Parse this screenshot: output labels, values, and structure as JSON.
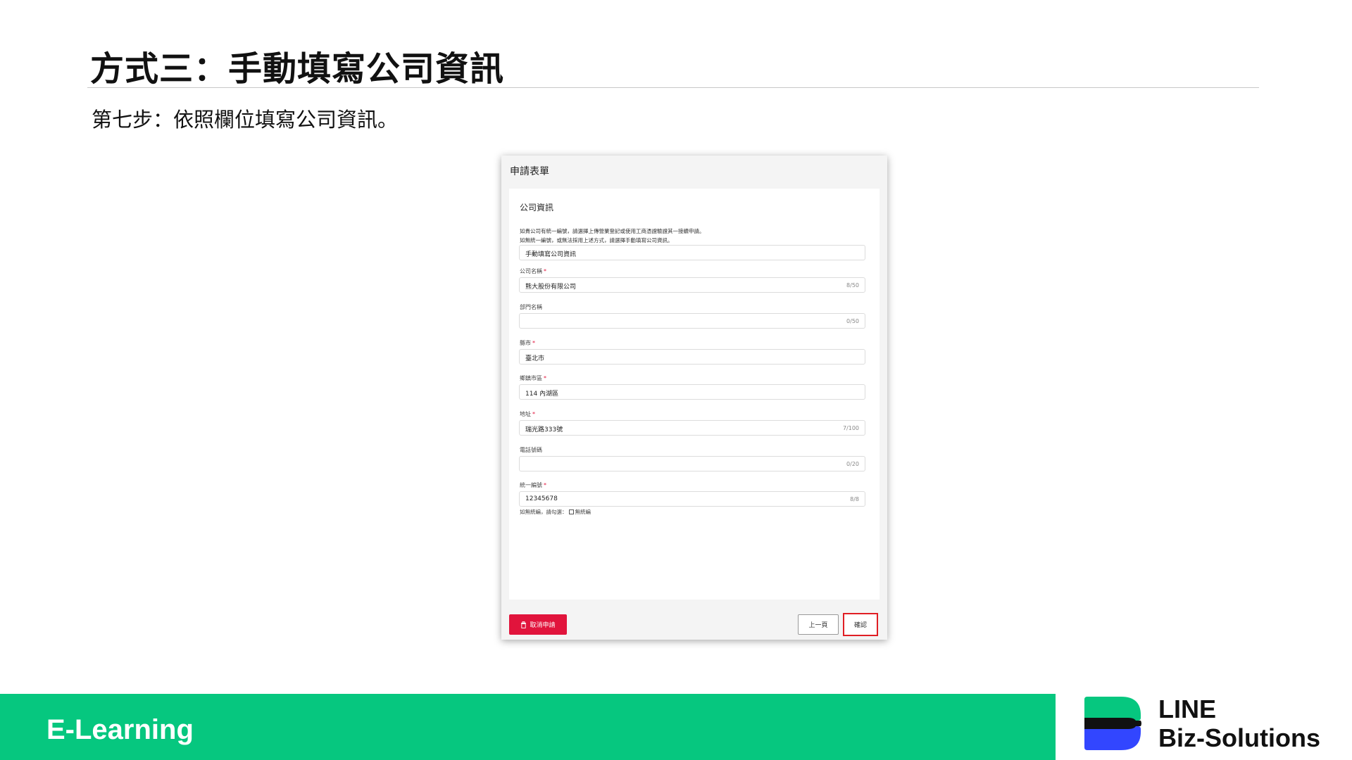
{
  "slide": {
    "title": "方式三：手動填寫公司資訊",
    "step": "第七步：依照欄位填寫公司資訊。"
  },
  "form": {
    "header": "申請表單",
    "section_title": "公司資訊",
    "help_line1": "如貴公司有統一編號，請選擇上傳營業登記或使用工商憑證驗證其一接續申請。",
    "help_line2": "如無統一編號，或無法採用上述方式，請選擇手動填寫公司資訊。",
    "method_select": "手動填寫公司資訊",
    "required_mark": "*",
    "fields": [
      {
        "label": "公司名稱",
        "required": true,
        "value": "熊大股份有限公司",
        "count": "8/50"
      },
      {
        "label": "部門名稱",
        "required": false,
        "value": "",
        "count": "0/50"
      },
      {
        "label": "縣市",
        "required": true,
        "value": "臺北市",
        "count": ""
      },
      {
        "label": "鄉鎮市區",
        "required": true,
        "value": "114 內湖區",
        "count": ""
      },
      {
        "label": "地址",
        "required": true,
        "value": "瑞光路333號",
        "count": "7/100"
      },
      {
        "label": "電話號碼",
        "required": false,
        "value": "",
        "count": "0/20"
      },
      {
        "label": "統一編號",
        "required": true,
        "value": "12345678",
        "count": "8/8"
      }
    ],
    "no_tax_note": "如無統編，請勾選：",
    "no_tax_checkbox_label": "無統編",
    "cancel_button": "取消申請",
    "prev_button": "上一頁",
    "confirm_button": "確認"
  },
  "footer": {
    "label": "E-Learning",
    "logo_line1": "LINE",
    "logo_line2": "Biz-Solutions"
  },
  "colors": {
    "brand_green": "#06c77f",
    "cancel_red": "#e1143c",
    "highlight_red": "#e01e24",
    "logo_blue": "#3246ff"
  }
}
